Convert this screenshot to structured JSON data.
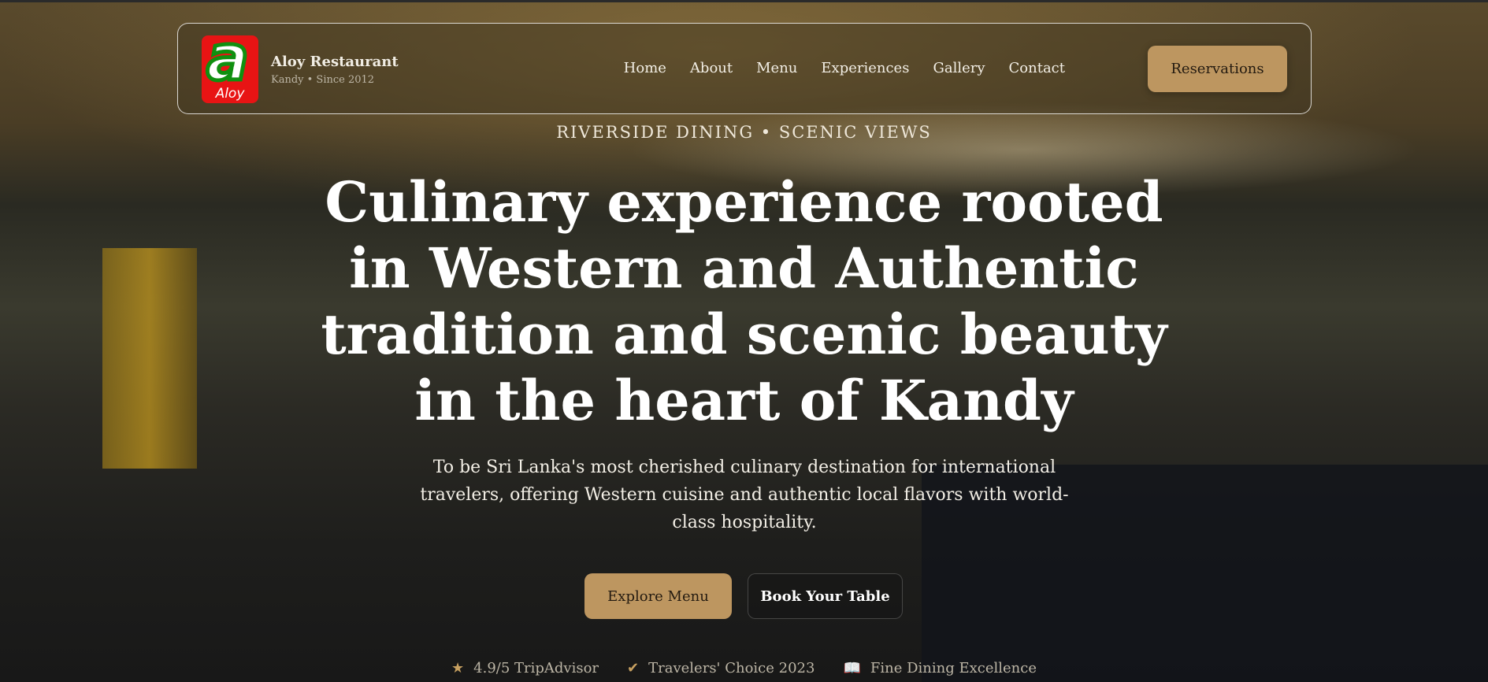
{
  "nav": {
    "brand": "Aloy Restaurant",
    "tagline": "Kandy • Since 2012",
    "logo_text": "Aloy",
    "links": [
      "Home",
      "About",
      "Menu",
      "Experiences",
      "Gallery",
      "Contact"
    ],
    "cta": "Reservations"
  },
  "hero": {
    "kicker": "RIVERSIDE DINING • SCENIC VIEWS",
    "title": "Culinary experience rooted in Western and Authentic tradition and scenic beauty in the heart of Kandy",
    "description": "To be Sri Lanka's most cherished culinary destination for international travelers, offering Western cuisine and authentic local flavors with world-class hospitality.",
    "primary_button": "Explore Menu",
    "secondary_button": "Book Your Table"
  },
  "badges": [
    {
      "icon": "star-icon",
      "label": "4.9/5 TripAdvisor"
    },
    {
      "icon": "verified-badge-icon",
      "label": "Travelers' Choice 2023"
    },
    {
      "icon": "book-icon",
      "label": "Fine Dining Excellence"
    }
  ],
  "colors": {
    "accent": "#bd9660"
  }
}
